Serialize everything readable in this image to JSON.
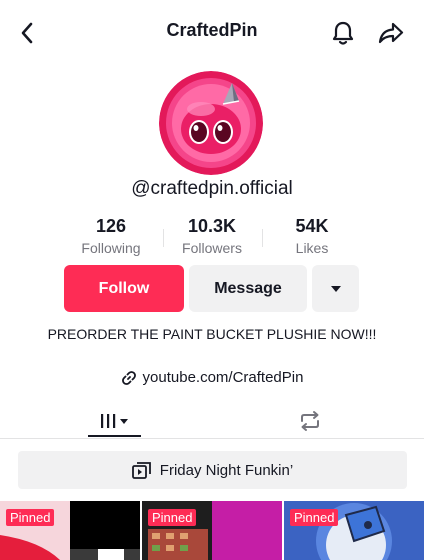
{
  "header": {
    "title": "CraftedPin"
  },
  "profile": {
    "handle": "@craftedpin.official",
    "stats": [
      {
        "value": "126",
        "label": "Following"
      },
      {
        "value": "10.3K",
        "label": "Followers"
      },
      {
        "value": "54K",
        "label": "Likes"
      }
    ],
    "bio": "PREORDER THE PAINT BUCKET PLUSHIE NOW!!!",
    "link": "youtube.com/CraftedPin"
  },
  "actions": {
    "follow": "Follow",
    "message": "Message"
  },
  "playlist": {
    "label": "Friday Night Funkin’"
  },
  "videos": [
    {
      "badge": "Pinned"
    },
    {
      "badge": "Pinned"
    },
    {
      "badge": "Pinned"
    }
  ],
  "colors": {
    "accent": "#fe2c55",
    "avatar": "#e3195a"
  }
}
